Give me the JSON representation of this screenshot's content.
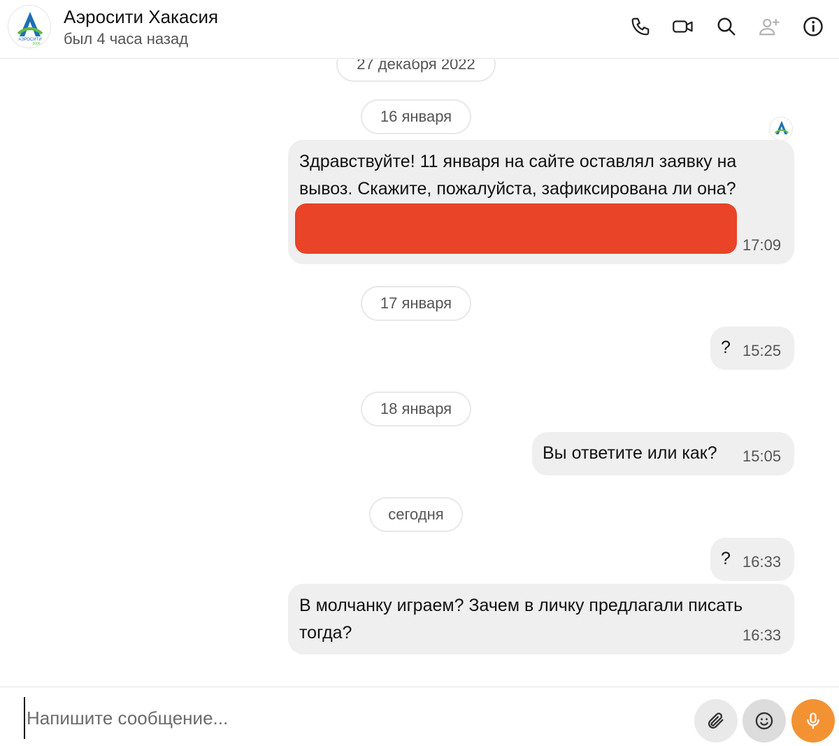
{
  "header": {
    "title": "Аэросити Хакасия",
    "subtitle": "был 4 часа назад",
    "avatar_logo_text": "АЭРОСИТИ 2000",
    "icons": [
      "phone-icon",
      "video-icon",
      "search-icon",
      "add-user-icon",
      "info-icon"
    ]
  },
  "chat": {
    "dates": [
      "27 декабря 2022",
      "16 января",
      "17 января",
      "18 января",
      "сегодня"
    ],
    "messages": [
      {
        "text": "Здравствуйте! 11 января на сайте оставлял заявку на вывоз. Скажите, пожалуйста, зафиксирована ли она?",
        "time": "17:09",
        "redacted": true
      },
      {
        "text": "?",
        "time": "15:25"
      },
      {
        "text": "Вы ответите или как?",
        "time": "15:05"
      },
      {
        "text": "?",
        "time": "16:33"
      },
      {
        "text": "В молчанку играем? Зачем в личку предлагали писать тогда?",
        "time": "16:33"
      }
    ]
  },
  "composer": {
    "placeholder": "Напишите сообщение...",
    "icons": [
      "attach-icon",
      "emoji-icon",
      "microphone-icon"
    ]
  },
  "colors": {
    "bubble": "#efefef",
    "redaction": "#e94328",
    "mic_button": "#f39232",
    "logo_blue": "#1d6fb8",
    "logo_green": "#62b846"
  }
}
